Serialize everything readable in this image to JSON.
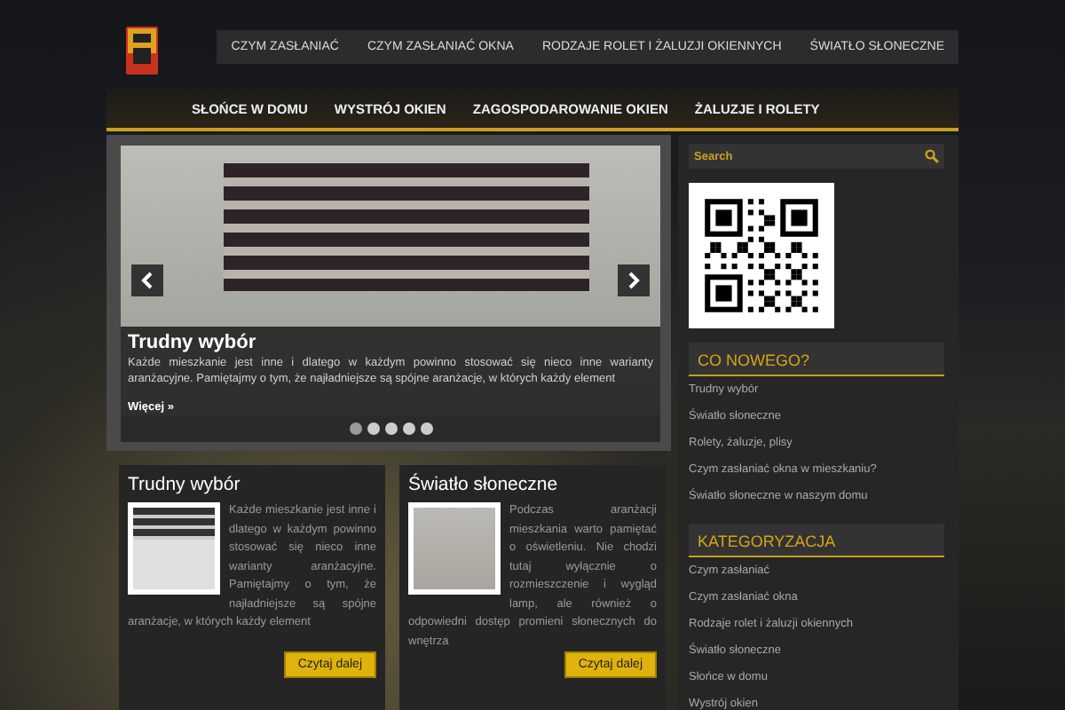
{
  "top_nav": [
    {
      "label": "CZYM ZASŁANIAĆ"
    },
    {
      "label": "CZYM ZASŁANIAĆ OKNA"
    },
    {
      "label": "RODZAJE ROLET I ŻALUZJI OKIENNYCH"
    },
    {
      "label": "ŚWIATŁO SŁONECZNE"
    }
  ],
  "main_nav": [
    {
      "label": "SŁOŃCE W DOMU"
    },
    {
      "label": "WYSTRÓJ OKIEN"
    },
    {
      "label": "ZAGOSPODAROWANIE OKIEN"
    },
    {
      "label": "ŻALUZJE I ROLETY"
    }
  ],
  "slider": {
    "title": "Trudny wybór",
    "text": "Każde mieszkanie jest inne i dlatego w każdym powinno stosować się nieco inne warianty aranżacyjne. Pamiętajmy o tym, że najładniejsze są spójne aranżacje, w których każdy element",
    "more": "Więcej »",
    "dots": [
      {
        "selected": true
      },
      {
        "selected": false
      },
      {
        "selected": false
      },
      {
        "selected": false
      },
      {
        "selected": false
      }
    ]
  },
  "cards": [
    {
      "title": "Trudny wybór",
      "text": "Każde mieszkanie jest inne i dlatego w każdym powinno stosować się nieco inne warianty aranżacyjne. Pamiętajmy o tym, że najładniejsze są spójne aranżacje, w których każdy element",
      "button": "Czytaj dalej"
    },
    {
      "title": "Światło słoneczne",
      "text": "Podczas aranżacji mieszkania warto pamiętać o oświetleniu. Nie chodzi tutaj wyłącznie o rozmieszczenie i wygląd lamp, ale również o odpowiedni dostęp promieni słonecznych do wnętrza",
      "button": "Czytaj dalej"
    }
  ],
  "sidebar": {
    "search": {
      "placeholder": "Search"
    },
    "widgets": [
      {
        "title": "CO NOWEGO?",
        "links": [
          "Trudny wybór",
          "Światło słoneczne",
          "Rolety, żaluzje, plisy",
          "Czym zasłaniać okna w mieszkaniu?",
          "Światło słoneczne w naszym domu"
        ]
      },
      {
        "title": "KATEGORYZACJA",
        "links": [
          "Czym zasłaniać",
          "Czym zasłaniać okna",
          "Rodzaje rolet i żaluzji okiennych",
          "Światło słoneczne",
          "Słońce w domu",
          "Wystrój okien"
        ]
      }
    ]
  }
}
